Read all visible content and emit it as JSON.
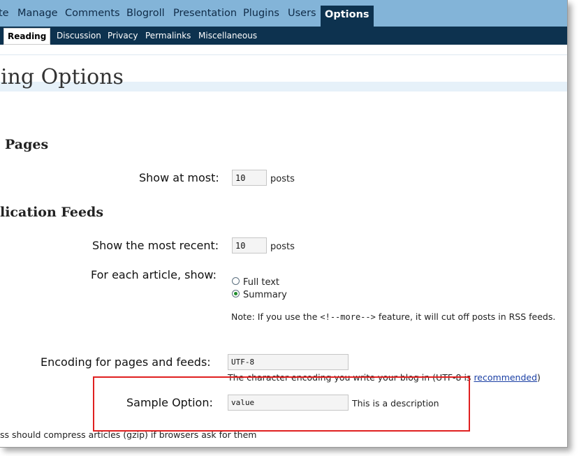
{
  "menu": {
    "items": [
      {
        "label": "te"
      },
      {
        "label": "Manage"
      },
      {
        "label": "Comments"
      },
      {
        "label": "Blogroll"
      },
      {
        "label": "Presentation"
      },
      {
        "label": "Plugins"
      },
      {
        "label": "Users"
      },
      {
        "label": "Options",
        "current": true
      }
    ]
  },
  "submenu": {
    "items": [
      {
        "label": "Reading",
        "current": true
      },
      {
        "label": "Discussion"
      },
      {
        "label": "Privacy"
      },
      {
        "label": "Permalinks"
      },
      {
        "label": "Miscellaneous"
      }
    ]
  },
  "page": {
    "title": "ing Options"
  },
  "sections": {
    "pages": {
      "title": "Pages",
      "show_at_most_label": "Show at most:",
      "show_at_most_value": "10",
      "unit": "posts"
    },
    "feeds": {
      "title": "lication Feeds",
      "recent_label": "Show the most recent:",
      "recent_value": "10",
      "unit": "posts",
      "article_label": "For each article, show:",
      "options": [
        {
          "label": "Full text",
          "checked": false
        },
        {
          "label": "Summary",
          "checked": true
        }
      ],
      "note_prefix": "Note: If you use the ",
      "note_code": "<!--more-->",
      "note_suffix": " feature, it will cut off posts in RSS feeds."
    },
    "encoding": {
      "label": "Encoding for pages and feeds:",
      "value": "UTF-8",
      "desc_prefix": "The character encoding you write your blog in (UTF-8 is ",
      "desc_link": "recommended",
      "desc_suffix": ")"
    },
    "sample": {
      "label": "Sample Option:",
      "value": "value",
      "description": "This is a description"
    },
    "gzip": {
      "text": "ss should compress articles (gzip) if browsers ask for them"
    }
  },
  "colors": {
    "menu_bg": "#83b4d8",
    "submenu_bg": "#0d324f",
    "highlight_border": "#e02020",
    "link": "#1a3fa4",
    "radio_checked": "#1e8c2b"
  }
}
